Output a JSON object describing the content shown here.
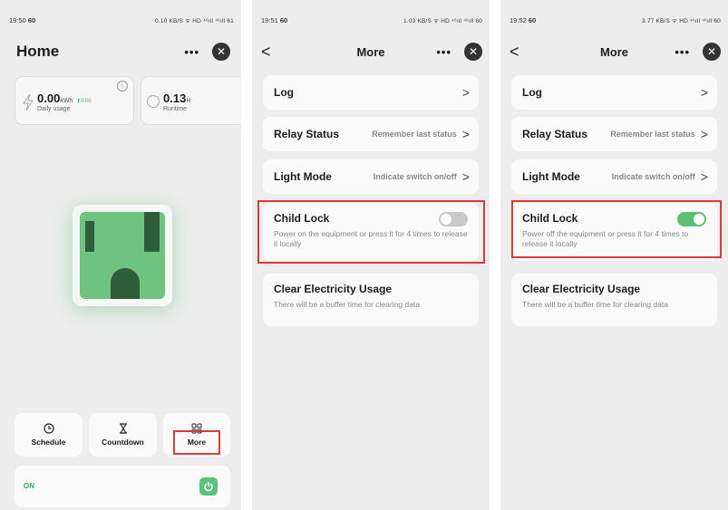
{
  "home": {
    "status_time": "19:50",
    "status_badge": "60",
    "status_icons": "0.10 KB/S ᯤ HD ⁴⁶ıll ⁴⁶ıll 61",
    "title": "Home",
    "dots": "•••",
    "close": "✕",
    "daily_value": "0.00",
    "daily_unit": "kWh",
    "daily_delta": "0.00",
    "daily_label": "Daily usage",
    "runtime_value": "0.13",
    "runtime_unit": "H",
    "runtime_label": "Runtime",
    "info": "!",
    "buttons": {
      "schedule": "Schedule",
      "countdown": "Countdown",
      "more": "More"
    },
    "on_label": "ON"
  },
  "more1": {
    "status_time": "19:51",
    "status_badge": "60",
    "status_icons": "1.03 KB/S ᯤ HD ⁴⁶ıll ⁴⁶ıll 60",
    "title": "More",
    "back": "<",
    "dots": "•••",
    "close": "✕",
    "log": "Log",
    "relay_title": "Relay Status",
    "relay_value": "Remember last status",
    "light_title": "Light Mode",
    "light_value": "Indicate switch on/off",
    "child_title": "Child Lock",
    "child_desc": "Power on the equipment or press it for 4 times to release it locally",
    "child_toggle": "off",
    "clear_title": "Clear Electricity Usage",
    "clear_desc": "There will be a buffer time for clearing data",
    "chev": ">"
  },
  "more2": {
    "status_time": "19:52",
    "status_badge": "60",
    "status_icons": "3.77 KB/S ᯤ HD ⁴⁶ıll ⁴⁶ıll 60",
    "title": "More",
    "back": "<",
    "dots": "•••",
    "close": "✕",
    "log": "Log",
    "relay_title": "Relay Status",
    "relay_value": "Remember last status",
    "light_title": "Light Mode",
    "light_value": "Indicate switch on/off",
    "child_title": "Child Lock",
    "child_desc": "Power off the equipment or press it for 4 times to release it locally",
    "child_toggle": "on",
    "clear_title": "Clear Electricity Usage",
    "clear_desc": "There will be a buffer time for clearing data",
    "chev": ">"
  },
  "colors": {
    "accent_green": "#5cbf76",
    "highlight_red": "#d93a3a"
  }
}
